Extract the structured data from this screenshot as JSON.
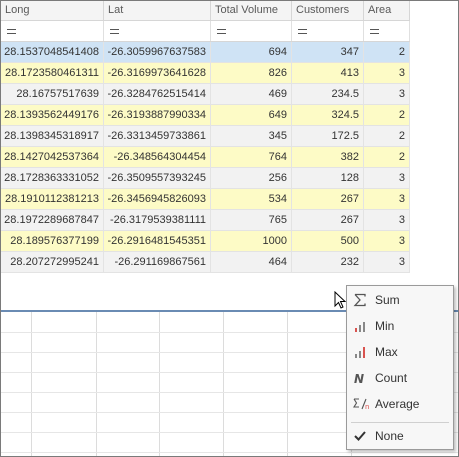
{
  "columns": [
    "Long",
    "Lat",
    "Total Volume",
    "Customers",
    "Area"
  ],
  "rows": [
    [
      "28.1537048541408",
      "-26.3059967637583",
      "694",
      "347",
      "2"
    ],
    [
      "28.1723580461311",
      "-26.3169973641628",
      "826",
      "413",
      "3"
    ],
    [
      "28.16757517639",
      "-26.3284762515414",
      "469",
      "234.5",
      "3"
    ],
    [
      "28.1393562449176",
      "-26.3193887990334",
      "649",
      "324.5",
      "2"
    ],
    [
      "28.1398345318917",
      "-26.3313459733861",
      "345",
      "172.5",
      "2"
    ],
    [
      "28.1427042537364",
      "-26.348564304454",
      "764",
      "382",
      "2"
    ],
    [
      "28.1728363331052",
      "-26.3509557393245",
      "256",
      "128",
      "3"
    ],
    [
      "28.1910112381213",
      "-26.3456945826093",
      "534",
      "267",
      "3"
    ],
    [
      "28.1972289687847",
      "-26.3179539381111",
      "765",
      "267",
      "3"
    ],
    [
      "28.189576377199",
      "-26.2916481545351",
      "1000",
      "500",
      "3"
    ],
    [
      "28.207272995241",
      "-26.291169867561",
      "464",
      "232",
      "3"
    ]
  ],
  "context_menu": {
    "items": [
      {
        "label": "Sum",
        "icon": "sigma-icon"
      },
      {
        "label": "Min",
        "icon": "min-bars-icon"
      },
      {
        "label": "Max",
        "icon": "max-bars-icon"
      },
      {
        "label": "Count",
        "icon": "count-n-icon"
      },
      {
        "label": "Average",
        "icon": "average-icon"
      },
      {
        "label": "None",
        "icon": "check-icon"
      }
    ],
    "checked_item": "None"
  },
  "colors": {
    "selected_row": "#cfe3f5",
    "highlight_row": "#fdfbc6",
    "alt_row": "#f2f2f2",
    "splitter": "#6a8bb3",
    "icon_red": "#d9534f"
  }
}
